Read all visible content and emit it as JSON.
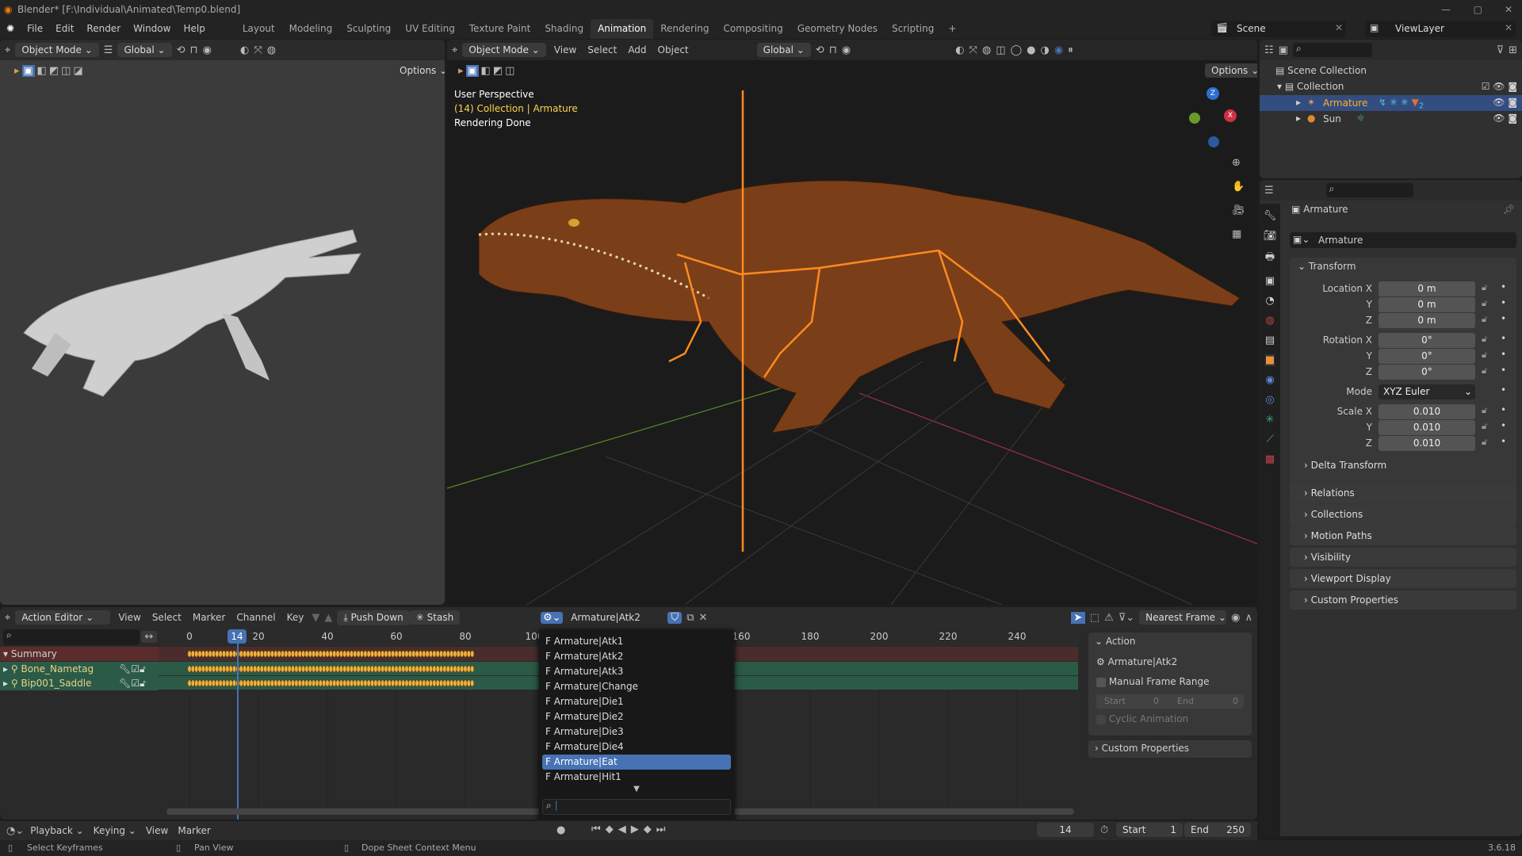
{
  "window": {
    "title": "Blender* [F:\\Individual\\Animated\\Temp0.blend]"
  },
  "menu": {
    "items": [
      "File",
      "Edit",
      "Render",
      "Window",
      "Help"
    ]
  },
  "workspaces": [
    "Layout",
    "Modeling",
    "Sculpting",
    "UV Editing",
    "Texture Paint",
    "Shading",
    "Animation",
    "Rendering",
    "Compositing",
    "Geometry Nodes",
    "Scripting"
  ],
  "active_workspace": "Animation",
  "scene": {
    "name": "Scene",
    "view_layer": "ViewLayer"
  },
  "left_viewport": {
    "mode": "Object Mode",
    "orientation": "Global",
    "options": "Options"
  },
  "main_viewport": {
    "mode": "Object Mode",
    "menus": [
      "View",
      "Select",
      "Add",
      "Object"
    ],
    "orientation": "Global",
    "options": "Options",
    "overlay": {
      "perspective": "User Perspective",
      "collection": "(14) Collection | Armature",
      "status": "Rendering Done"
    }
  },
  "outliner": {
    "scene_collection": "Scene Collection",
    "collection": "Collection",
    "items": [
      {
        "name": "Armature",
        "selected": true
      },
      {
        "name": "Sun",
        "selected": false
      }
    ],
    "badge": "2"
  },
  "properties": {
    "object_name": "Armature",
    "data_name": "Armature",
    "transform_title": "Transform",
    "location": {
      "label": "Location X",
      "x": "0 m",
      "y": "0 m",
      "z": "0 m"
    },
    "rotation": {
      "label": "Rotation X",
      "x": "0°",
      "y": "0°",
      "z": "0°"
    },
    "mode": {
      "label": "Mode",
      "value": "XYZ Euler"
    },
    "scale": {
      "label": "Scale X",
      "x": "0.010",
      "y": "0.010",
      "z": "0.010"
    },
    "axis": {
      "y": "Y",
      "z": "Z"
    },
    "panels": [
      "Delta Transform",
      "Relations",
      "Collections",
      "Motion Paths",
      "Visibility",
      "Viewport Display",
      "Custom Properties"
    ]
  },
  "action_editor": {
    "mode": "Action Editor",
    "menus": [
      "View",
      "Select",
      "Marker",
      "Channel",
      "Key"
    ],
    "push_down": "Push Down",
    "stash": "Stash",
    "action": "Armature|Atk2",
    "snap": "Nearest Frame",
    "ticks": [
      0,
      20,
      40,
      60,
      80,
      100,
      160,
      180,
      200,
      220,
      240
    ],
    "current_frame": "14",
    "channels": [
      {
        "name": "Summary"
      },
      {
        "name": "Bone_Nametag"
      },
      {
        "name": "Bip001_Saddle"
      }
    ],
    "dropdown": [
      "F Armature|Atk1",
      "F Armature|Atk2",
      "F Armature|Atk3",
      "F Armature|Change",
      "F Armature|Die1",
      "F Armature|Die2",
      "F Armature|Die3",
      "F Armature|Die4",
      "F Armature|Eat",
      "F Armature|Hit1"
    ],
    "dropdown_selected": "F Armature|Eat",
    "sidebar": {
      "title": "Action",
      "action_name": "Armature|Atk2",
      "manual_range": "Manual Frame Range",
      "start_label": "Start",
      "start": "0",
      "end_label": "End",
      "end": "0",
      "cyclic": "Cyclic Animation",
      "custom": "Custom Properties"
    }
  },
  "timeline": {
    "menus": [
      "Playback",
      "Keying",
      "View",
      "Marker"
    ],
    "frame": "14",
    "start_label": "Start",
    "start": "1",
    "end_label": "End",
    "end": "250"
  },
  "statusbar": {
    "select": "Select Keyframes",
    "pan": "Pan View",
    "context": "Dope Sheet Context Menu",
    "version": "3.6.18"
  }
}
